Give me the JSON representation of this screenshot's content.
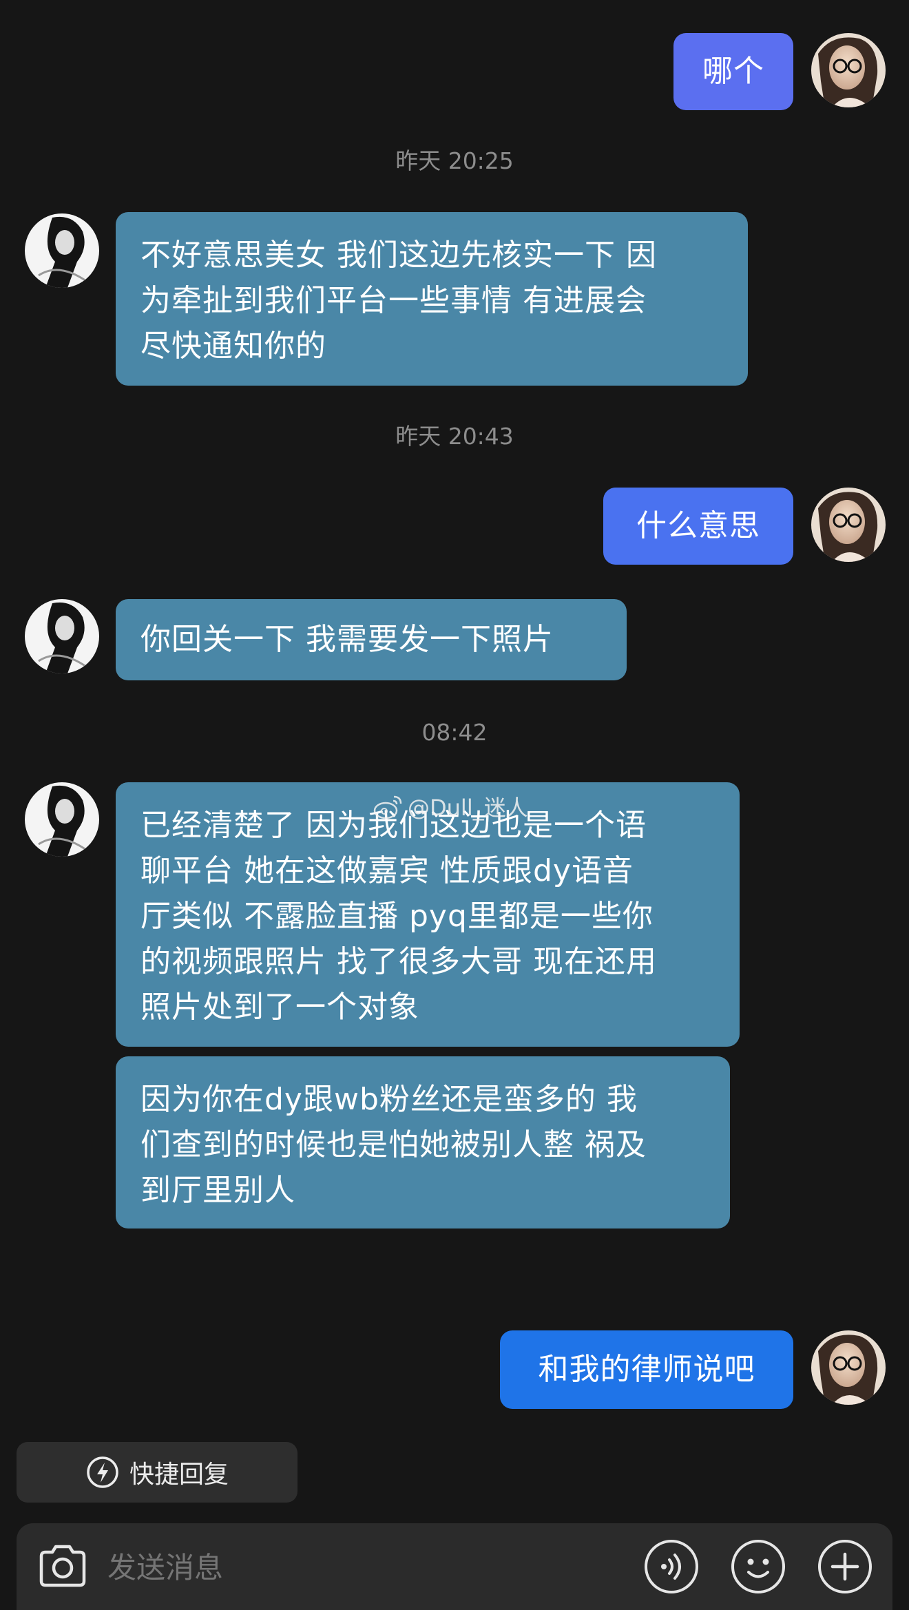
{
  "messages": {
    "m1": "哪个",
    "m2": [
      "不好意思美女 我们这边先核实一下  因",
      "为牵扯到我们平台一些事情  有进展会",
      "尽快通知你的"
    ],
    "m3": "什么意思",
    "m4": "你回关一下 我需要发一下照片",
    "m5": [
      "已经清楚了 因为我们这边也是一个语",
      "聊平台 她在这做嘉宾 性质跟dy语音",
      "厅类似 不露脸直播 pyq里都是一些你",
      "的视频跟照片 找了很多大哥 现在还用",
      "照片处到了一个对象"
    ],
    "m6": [
      "因为你在dy跟wb粉丝还是蛮多的 我",
      "们查到的时候也是怕她被别人整 祸及",
      "到厅里别人"
    ],
    "m7": "和我的律师说吧"
  },
  "timestamps": {
    "t1": "昨天 20:25",
    "t2": "昨天 20:43",
    "t3": "08:42"
  },
  "watermark": "@Dull_迷人",
  "quick_reply": {
    "label": "快捷回复",
    "icon": "lightning-icon"
  },
  "input": {
    "placeholder": "发送消息",
    "value": ""
  },
  "icons": [
    "camera-icon",
    "voice-icon",
    "emoji-icon",
    "plus-icon"
  ],
  "colors": {
    "background": "#161616",
    "incoming_bubble": "#4a87a7",
    "outgoing_bubble_1": "#5b6ff0",
    "outgoing_bubble_2": "#4a72f0",
    "outgoing_bubble_3": "#1f74e8"
  }
}
